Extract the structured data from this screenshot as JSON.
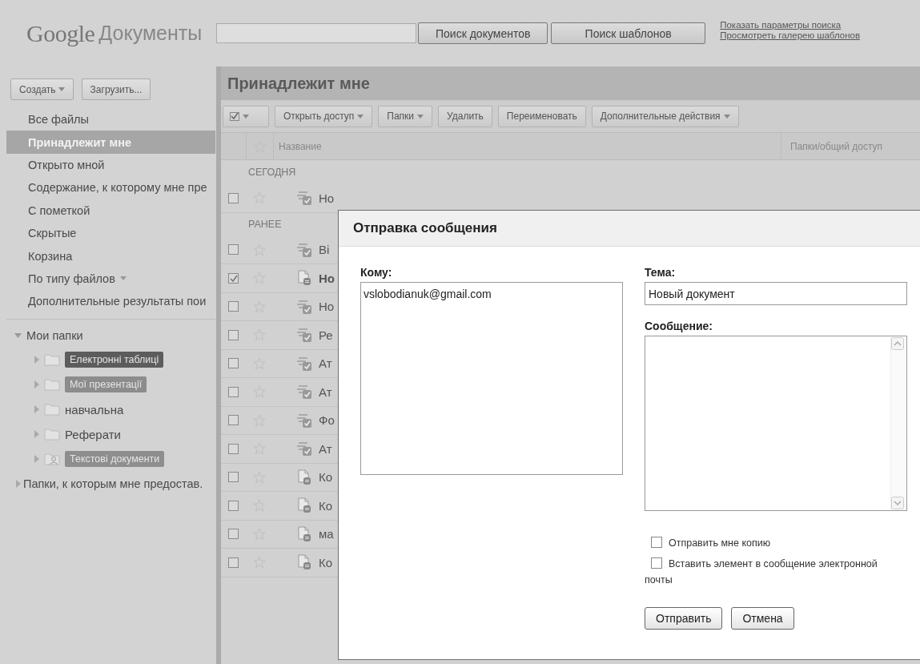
{
  "header": {
    "logo": "Google",
    "product": "Документы",
    "search_buttons": [
      "Поиск документов",
      "Поиск шаблонов"
    ],
    "links": [
      "Показать параметры поиска",
      "Просмотреть галерею шаблонов"
    ]
  },
  "sidebar": {
    "buttons": [
      {
        "label": "Создать",
        "has_menu": true
      },
      {
        "label": "Загрузить...",
        "has_menu": false
      }
    ],
    "items": [
      {
        "label": "Все файлы",
        "selected": false,
        "has_menu": false
      },
      {
        "label": "Принадлежит мне",
        "selected": true,
        "has_menu": false
      },
      {
        "label": "Открыто мной",
        "selected": false,
        "has_menu": false
      },
      {
        "label": "Содержание, к которому мне пре",
        "selected": false,
        "has_menu": false
      },
      {
        "label": "С пометкой",
        "selected": false,
        "has_menu": false
      },
      {
        "label": "Скрытые",
        "selected": false,
        "has_menu": false
      },
      {
        "label": "Корзина",
        "selected": false,
        "has_menu": false
      },
      {
        "label": "По типу файлов",
        "selected": false,
        "has_menu": true
      },
      {
        "label": "Дополнительные результаты пои",
        "selected": false,
        "has_menu": false
      }
    ],
    "folders": {
      "label": "Мои папки",
      "expanded": true,
      "children": [
        {
          "label": "Електронні таблиці",
          "kind": "folder",
          "color": "#5c5c5c"
        },
        {
          "label": "Мої презентації",
          "kind": "folder",
          "color": "#8c8c8c"
        },
        {
          "label": "навчальна",
          "kind": "folder"
        },
        {
          "label": "Реферати",
          "kind": "folder"
        },
        {
          "label": "Текстові документи",
          "kind": "shared",
          "color": "#8e8e8e"
        }
      ]
    },
    "shared": {
      "label": "Папки, к которым мне предостав.",
      "expanded": false
    }
  },
  "main": {
    "title": "Принадлежит мне",
    "toolbar": [
      {
        "label": "Открыть доступ",
        "has_menu": true
      },
      {
        "label": "Папки",
        "has_menu": true
      },
      {
        "label": "Удалить",
        "has_menu": false
      },
      {
        "label": "Переименовать",
        "has_menu": false
      },
      {
        "label": "Дополнительные действия",
        "has_menu": true
      }
    ],
    "columns": [
      "Название",
      "Папки/общий доступ"
    ],
    "groups": [
      {
        "label": "СЕГОДНЯ",
        "rows": [
          {
            "name": "Но",
            "kind": "form",
            "checked": false
          }
        ]
      },
      {
        "label": "РАНЕЕ",
        "rows": [
          {
            "name": "Ві",
            "kind": "form",
            "checked": false
          },
          {
            "name": "Но",
            "kind": "doc",
            "checked": true
          },
          {
            "name": "Но",
            "kind": "form",
            "checked": false
          },
          {
            "name": "Ре",
            "kind": "form",
            "checked": false
          },
          {
            "name": "Ат",
            "kind": "form",
            "checked": false
          },
          {
            "name": "Ат",
            "kind": "form",
            "checked": false
          },
          {
            "name": "Фо",
            "kind": "form",
            "checked": false
          },
          {
            "name": "Ат",
            "kind": "form",
            "checked": false
          },
          {
            "name": "Ко",
            "kind": "doc",
            "checked": false
          },
          {
            "name": "Ко",
            "kind": "doc",
            "checked": false
          },
          {
            "name": "ма",
            "kind": "doc",
            "checked": false
          },
          {
            "name": "Ко",
            "kind": "doc",
            "checked": false
          }
        ]
      }
    ]
  },
  "dialog": {
    "title": "Отправка сообщения",
    "to_label": "Кому:",
    "to_value": "vslobodianuk@gmail.com",
    "subject_label": "Тема:",
    "subject_value": "Новый документ",
    "message_label": "Сообщение:",
    "options": [
      {
        "label": "Отправить мне копию",
        "checked": false
      },
      {
        "label": "Вставить элемент в сообщение электронной почты",
        "checked": false
      }
    ],
    "buttons": [
      "Отправить",
      "Отмена"
    ]
  }
}
